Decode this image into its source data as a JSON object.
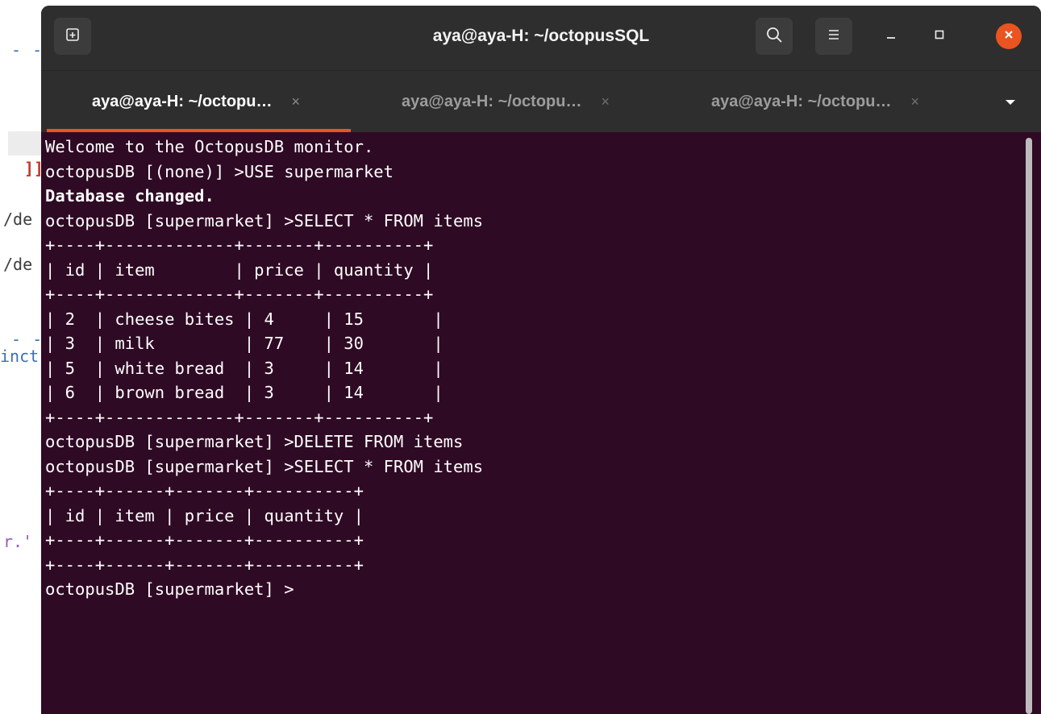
{
  "background_editor": {
    "fragments": [
      "- - -",
      "]]",
      "/de",
      "/de",
      "- - -",
      "inct",
      "r.'"
    ]
  },
  "window": {
    "title": "aya@aya-H: ~/octopusSQL"
  },
  "tabs": [
    {
      "label": "aya@aya-H: ~/octopu…",
      "close": "×",
      "active": true
    },
    {
      "label": "aya@aya-H: ~/octopu…",
      "close": "×",
      "active": false
    },
    {
      "label": "aya@aya-H: ~/octopu…",
      "close": "×",
      "active": false
    }
  ],
  "terminal": {
    "lines": [
      "Welcome to the OctopusDB monitor.",
      "octopusDB [(none)] >USE supermarket",
      "Database changed.",
      "octopusDB [supermarket] >SELECT * FROM items",
      "+----+-------------+-------+----------+",
      "| id | item        | price | quantity |",
      "+----+-------------+-------+----------+",
      "| 2  | cheese bites | 4     | 15       |",
      "| 3  | milk         | 77    | 30       |",
      "| 5  | white bread  | 3     | 14       |",
      "| 6  | brown bread  | 3     | 14       |",
      "+----+-------------+-------+----------+",
      "octopusDB [supermarket] >DELETE FROM items",
      "octopusDB [supermarket] >SELECT * FROM items",
      "+----+------+-------+----------+",
      "| id | item | price | quantity |",
      "+----+------+-------+----------+",
      "+----+------+-------+----------+",
      "octopusDB [supermarket] >"
    ]
  },
  "colors": {
    "terminal_bg": "#2f0a24",
    "titlebar_bg": "#2e2e2e",
    "accent": "#e95420",
    "text": "#ffffff"
  },
  "icons": {
    "new_tab": "new-tab-icon",
    "search": "search-icon",
    "menu": "hamburger-menu-icon",
    "minimize": "minimize-icon",
    "maximize": "maximize-icon",
    "close": "close-icon",
    "dropdown": "chevron-down-icon"
  }
}
